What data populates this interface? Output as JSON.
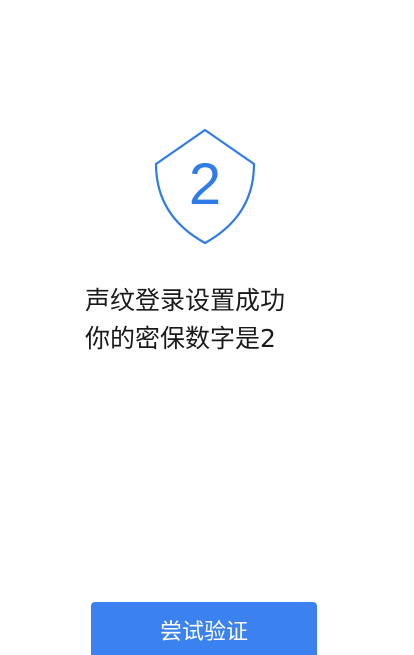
{
  "shield": {
    "digit": "2",
    "icon": "shield-icon",
    "color": "#2f7be8"
  },
  "message": {
    "line1": "声纹登录设置成功",
    "line2": "你的密保数字是2"
  },
  "button": {
    "label": "尝试验证",
    "color": "#3b82f0"
  }
}
